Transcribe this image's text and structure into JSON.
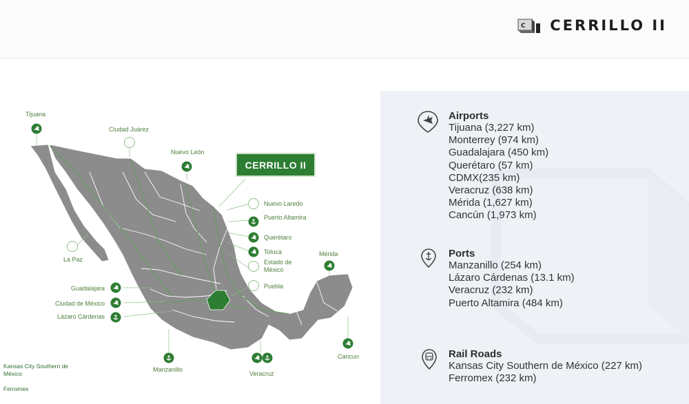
{
  "brand": {
    "logo_text": "C I",
    "title": "CERRILLO II"
  },
  "map": {
    "highlight_label": "CERRILLO II",
    "labels": {
      "tijuana": "Tijuana",
      "ciudad_juarez": "Ciudad Juárez",
      "nuevo_leon": "Nuevo León",
      "nuevo_laredo": "Nuevo Laredo",
      "puerto_altamira": "Puerto Altamira",
      "queretaro": "Querétaro",
      "toluca": "Toluca",
      "estado_mexico": "Estado de México",
      "puebla": "Puebla",
      "merida": "Mérida",
      "la_paz": "La Paz",
      "guadalajara": "Guadalajara",
      "ciudad_mexico": "Ciudad de México",
      "lazaro": "Lázaro Cárdenas",
      "manzanillo": "Manzanillo",
      "veracruz": "Veracruz",
      "cancun": "Cancun"
    },
    "rail_legend": {
      "kansas": "Kansas City Southern de México",
      "ferromex": "Ferromex"
    },
    "colors": {
      "land": "#8c8c8c",
      "highlight": "#2d7d32",
      "accent": "#4a8c3f"
    }
  },
  "panel": {
    "airports": {
      "icon": "airport-pin-icon",
      "title": "Airports",
      "items": [
        "Tijuana (3,227 km)",
        "Monterrey (974 km)",
        "Guadalajara (450 km)",
        "Querétaro (57 km)",
        "CDMX(235 km)",
        "Veracruz (638 km)",
        "Mérida (1,627 km)",
        "Cancún (1,973 km)"
      ]
    },
    "ports": {
      "icon": "anchor-pin-icon",
      "title": "Ports",
      "items": [
        "Manzanillo (254 km)",
        "Lázaro Cárdenas (13.1 km)",
        "Veracruz (232 km)",
        "Puerto Altamira (484 km)"
      ]
    },
    "rail": {
      "icon": "train-pin-icon",
      "title": "Rail Roads",
      "items": [
        "Kansas City Southern de México (227 km)",
        "Ferromex (232 km)"
      ]
    }
  }
}
